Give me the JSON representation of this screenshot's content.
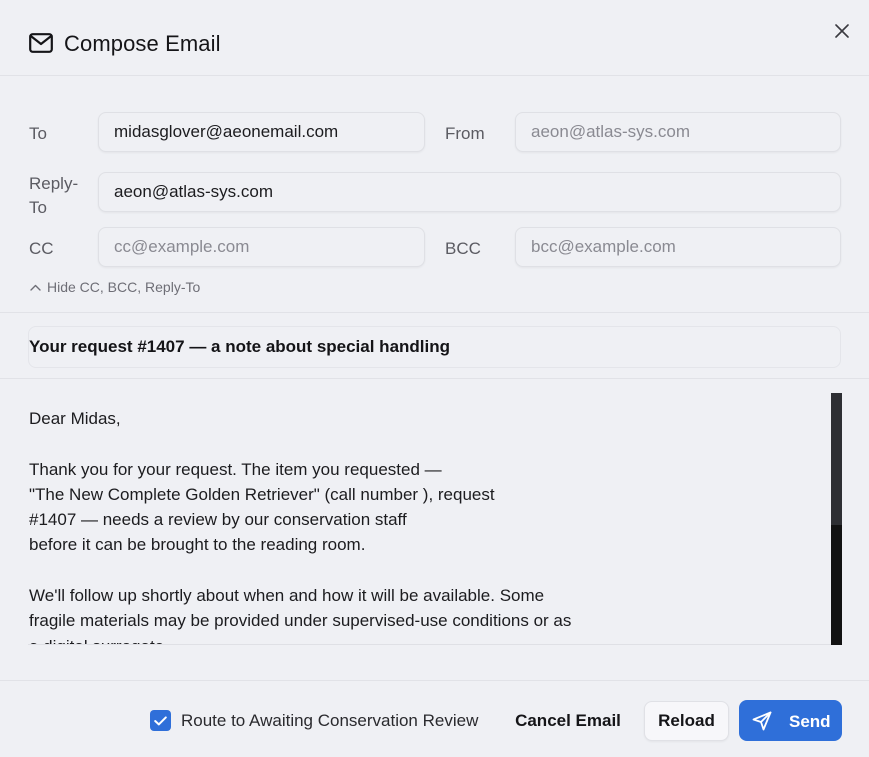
{
  "dialog": {
    "title": "Compose Email",
    "icons": {
      "title": "mail-icon",
      "close": "close-icon",
      "toggle": "chevron-up-icon",
      "checkbox": "check-icon",
      "send": "paper-plane-icon"
    }
  },
  "recipients": {
    "to_label": "To",
    "to_value": "midasglover@aeonemail.com",
    "from_label": "From",
    "from_placeholder": "aeon@atlas-sys.com",
    "reply_to_label": "Reply-\nTo",
    "reply_to_value": "aeon@atlas-sys.com",
    "cc_label": "CC",
    "cc_placeholder": "cc@example.com",
    "bcc_label": "BCC",
    "bcc_placeholder": "bcc@example.com",
    "toggle_label": "Hide CC, BCC, Reply-To"
  },
  "subject": {
    "value": "Your request #1407 — a note about special handling"
  },
  "body": {
    "text": "Dear Midas,\n\nThank you for your request. The item you requested —\n\"The New Complete Golden Retriever\" (call number ), request\n#1407 — needs a review by our conservation staff\nbefore it can be brought to the reading room.\n\nWe'll follow up shortly about when and how it will be available. Some\nfragile materials may be provided under supervised-use conditions or as\na digital surrogate."
  },
  "footer": {
    "route_checkbox_checked": true,
    "route_label": "Route to Awaiting Conservation Review",
    "cancel_label": "Cancel Email",
    "reload_label": "Reload",
    "send_label": "Send"
  },
  "colors": {
    "accent": "#2f6fd9",
    "background": "#eff0f4",
    "scrollbar_track": "#121212",
    "scrollbar_thumb": "#2e2f33"
  }
}
